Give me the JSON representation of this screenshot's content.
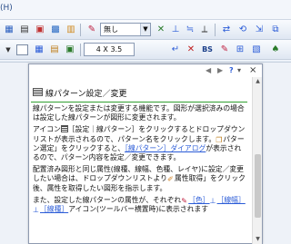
{
  "menubar": {
    "tail_text": "(H)"
  },
  "toolbar2": {
    "line_style_value": "無し",
    "size_value": "4 X 3.5",
    "bs_label": "BS"
  },
  "popup": {
    "nav_prev": "◀",
    "nav_next": "▶",
    "nav_help": "?",
    "close": "×",
    "title": "線パターン設定／変更",
    "p1": "線パターンを設定または変更する機能です。図形が選択済みの場合は設定した線パターンが図形に変更されます。",
    "p2_a": "アイコン",
    "p2_b": "［設定｜線パターン］をクリックするとドロップダウンリストが表示されるので、パターン名をクリックします。",
    "p2_c": "パターン選定」をクリックすると、",
    "p2_link": "［線パターン］ダイアログ",
    "p2_d": "が表示されるので、パターン内容を設定／変更できます。",
    "p3_a": "配置済み図形と同じ属性(線種、線幅、色種、レイヤ)に設定／変更したい場合は、ドロップダウンリストより",
    "p3_b": "属性取得」をクリック後、属性を取得したい図形を指示します。",
    "p4_a": "また、設定した線パターンの属性が、それぞれ",
    "p4_link1": "［色］",
    "p4_link2": "［線幅］",
    "p4_link3": "［線種］",
    "p4_b": "アイコン(ツールバー横置時)に表示されます"
  }
}
